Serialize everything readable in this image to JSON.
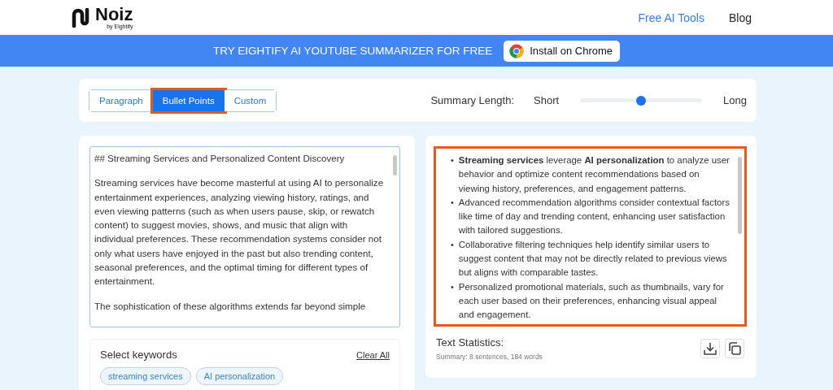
{
  "header": {
    "logo": "Noiz",
    "logo_sub": "by Eightify",
    "nav": [
      "Free AI Tools",
      "Blog"
    ]
  },
  "banner": {
    "text": "TRY EIGHTIFY AI YOUTUBE SUMMARIZER FOR FREE",
    "button": "Install on Chrome"
  },
  "modes": [
    {
      "label": "Paragraph",
      "selected": false
    },
    {
      "label": "Bullet Points",
      "selected": true
    },
    {
      "label": "Custom",
      "selected": false
    }
  ],
  "length": {
    "label": "Summary Length:",
    "min_label": "Short",
    "max_label": "Long",
    "level": 0.5
  },
  "input": {
    "paragraphs": [
      "## Streaming Services and Personalized Content Discovery",
      "Streaming services have become masterful at using AI to personalize entertainment experiences, analyzing viewing history, ratings, and even viewing patterns (such as when users pause, skip, or rewatch content) to suggest movies, shows, and music that align with individual preferences. These recommendation systems consider not only what users have enjoyed in the past but also trending content, seasonal preferences, and the optimal timing for different types of entertainment.",
      "The sophistication of these algorithms extends far beyond simple"
    ]
  },
  "keywords": {
    "title": "Select keywords",
    "clear": "Clear All",
    "items": [
      "streaming services",
      "AI personalization"
    ]
  },
  "summary": {
    "outlined": true,
    "marker": "•",
    "bullets": [
      "**Streaming services** leverage **AI personalization** to analyze user behavior and optimize content recommendations based on viewing history, preferences, and engagement patterns.",
      "Advanced recommendation algorithms consider contextual factors like time of day and trending content, enhancing user satisfaction with tailored suggestions.",
      "Collaborative filtering techniques help identify similar users to suggest content that may not be directly related to previous views but aligns with comparable tastes.",
      "Personalized promotional materials, such as thumbnails, vary for each user based on their preferences, enhancing visual appeal and engagement."
    ]
  },
  "stats": {
    "title": "Text Statistics:",
    "summary": "Summary: 8 sentences, 184 words"
  }
}
